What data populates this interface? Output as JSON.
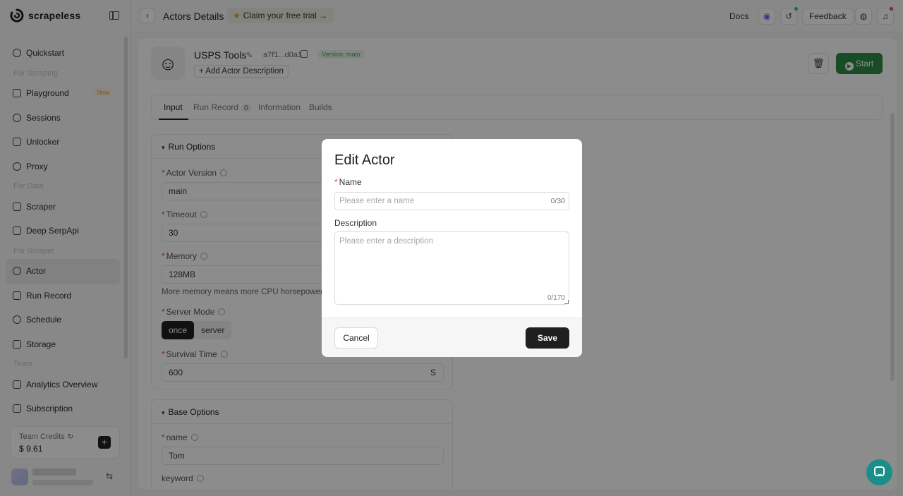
{
  "brand": {
    "name": "scrapeless"
  },
  "sidebar": {
    "items": [
      {
        "type": "item",
        "label": "Quickstart"
      },
      {
        "type": "section",
        "label": "For Scraping"
      },
      {
        "type": "item",
        "label": "Playground",
        "badge": "New"
      },
      {
        "type": "item",
        "label": "Sessions"
      },
      {
        "type": "item",
        "label": "Unlocker"
      },
      {
        "type": "item",
        "label": "Proxy"
      },
      {
        "type": "section",
        "label": "For Data"
      },
      {
        "type": "item",
        "label": "Scraper"
      },
      {
        "type": "item",
        "label": "Deep SerpApi"
      },
      {
        "type": "section",
        "label": "For Scraper"
      },
      {
        "type": "item",
        "label": "Actor",
        "active": true
      },
      {
        "type": "item",
        "label": "Run Record"
      },
      {
        "type": "item",
        "label": "Schedule"
      },
      {
        "type": "item",
        "label": "Storage"
      },
      {
        "type": "section",
        "label": "Team"
      },
      {
        "type": "item",
        "label": "Analytics Overview"
      },
      {
        "type": "item",
        "label": "Subscription"
      }
    ],
    "credits": {
      "label": "Team Credits",
      "value": "$ 9.61"
    }
  },
  "topbar": {
    "title": "Actors Details",
    "trial": "Claim your free trial →",
    "docs": "Docs",
    "feedback": "Feedback"
  },
  "actor": {
    "name": "USPS Tools",
    "id": "a7f1...d0a1",
    "version_tag": "Version: main",
    "add_description": "+ Add Actor Description",
    "start_label": "Start"
  },
  "tabs": [
    {
      "label": "Input",
      "active": true
    },
    {
      "label": "Run Record",
      "count": "0"
    },
    {
      "label": "Information"
    },
    {
      "label": "Builds"
    }
  ],
  "run_options": {
    "title": "Run Options",
    "actor_version_label": "Actor Version",
    "actor_version": "main",
    "timeout_label": "Timeout",
    "timeout": "30",
    "memory_label": "Memory",
    "memory": "128MB",
    "memory_hint": "More memory means more CPU horsepower, t",
    "server_mode_label": "Server Mode",
    "server_mode_options": [
      "once",
      "server"
    ],
    "server_mode_selected": "once",
    "survival_time_label": "Survival Time",
    "survival_time": "600",
    "survival_unit": "S"
  },
  "base_options": {
    "title": "Base Options",
    "name_label": "name",
    "name_value": "Tom",
    "keyword_label": "keyword"
  },
  "modal": {
    "title": "Edit Actor",
    "name_label": "Name",
    "name_placeholder": "Please enter a name",
    "name_count": "0/30",
    "description_label": "Description",
    "description_placeholder": "Please enter a description",
    "description_count": "0/170",
    "cancel_label": "Cancel",
    "save_label": "Save"
  },
  "colors": {
    "primary_green": "#2d8a46",
    "dark_button": "#1f1f1f",
    "required_red": "#e14a4a",
    "chat_teal": "#1a8f8a"
  }
}
